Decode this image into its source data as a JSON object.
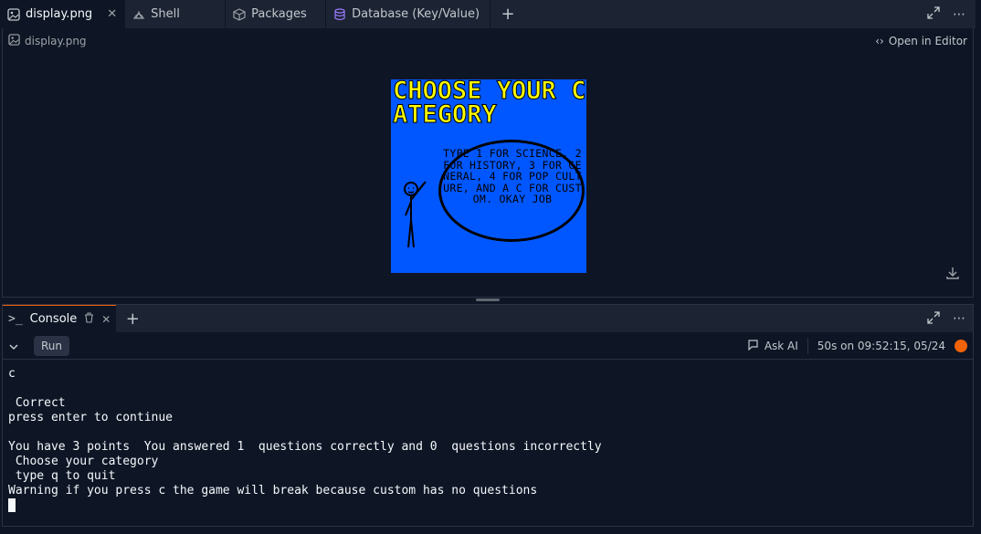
{
  "tabs": [
    {
      "label": "display.png",
      "icon": "image-icon",
      "active": true,
      "closable": true
    },
    {
      "label": "Shell",
      "icon": "shell-icon",
      "active": false
    },
    {
      "label": "Packages",
      "icon": "package-icon",
      "active": false
    },
    {
      "label": "Database (Key/Value)",
      "icon": "database-icon",
      "active": false
    }
  ],
  "display": {
    "filename": "display.png",
    "open_in_editor": "Open in Editor",
    "game": {
      "title": "CHOOSE YOUR CATEGORY",
      "bubble": "TYPE 1 FOR SCIENCE, 2 FOR HISTORY, 3 FOR GENERAL, 4 FOR POP CULTURE, AND A C FOR CUSTOM. OKAY JOB",
      "background": "#0057ff",
      "title_color": "#ffff00"
    }
  },
  "console": {
    "tab_label": "Console",
    "run_label": "Run",
    "ask_ai": "Ask AI",
    "run_status": "50s on 09:52:15, 05/24",
    "lines": [
      "c",
      "",
      " Correct",
      "press enter to continue",
      "",
      "You have 3 points  You answered 1  questions correctly and 0  questions incorrectly",
      " Choose your category",
      " type q to quit",
      "Warning if you press c the game will break because custom has no questions"
    ]
  },
  "colors": {
    "accent": "#f26207",
    "bg": "#0e1525",
    "surface": "#1c2333"
  }
}
